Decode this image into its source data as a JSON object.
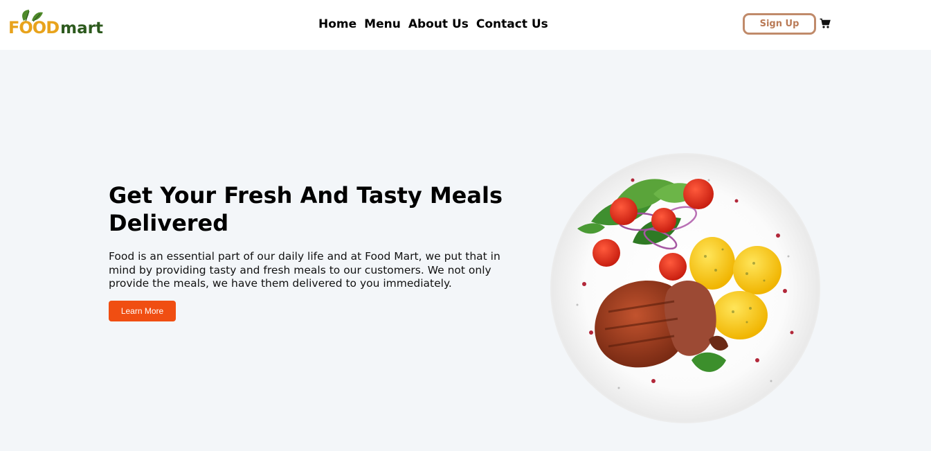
{
  "header": {
    "logo": {
      "food": "FOOD",
      "mart": "mart"
    },
    "nav": [
      {
        "label": "Home"
      },
      {
        "label": "Menu"
      },
      {
        "label": "About Us"
      },
      {
        "label": "Contact Us"
      }
    ],
    "signup_label": "Sign Up",
    "cart_icon": "cart-icon"
  },
  "hero": {
    "title": "Get Your Fresh And Tasty Meals Delivered",
    "text": "Food is an essential part of our daily life and at Food Mart, we put that in mind by providing tasty and fresh meals to our customers. We not only provide the meals, we have them delivered to you immediately.",
    "button_label": "Learn More",
    "image_icon": "food-plate-image"
  },
  "colors": {
    "accent": "#f04e12",
    "signup_border": "#c08a6a",
    "page_bg": "#f3f6f9",
    "logo_orange": "#e8a31c",
    "logo_green": "#2d5a1e"
  }
}
